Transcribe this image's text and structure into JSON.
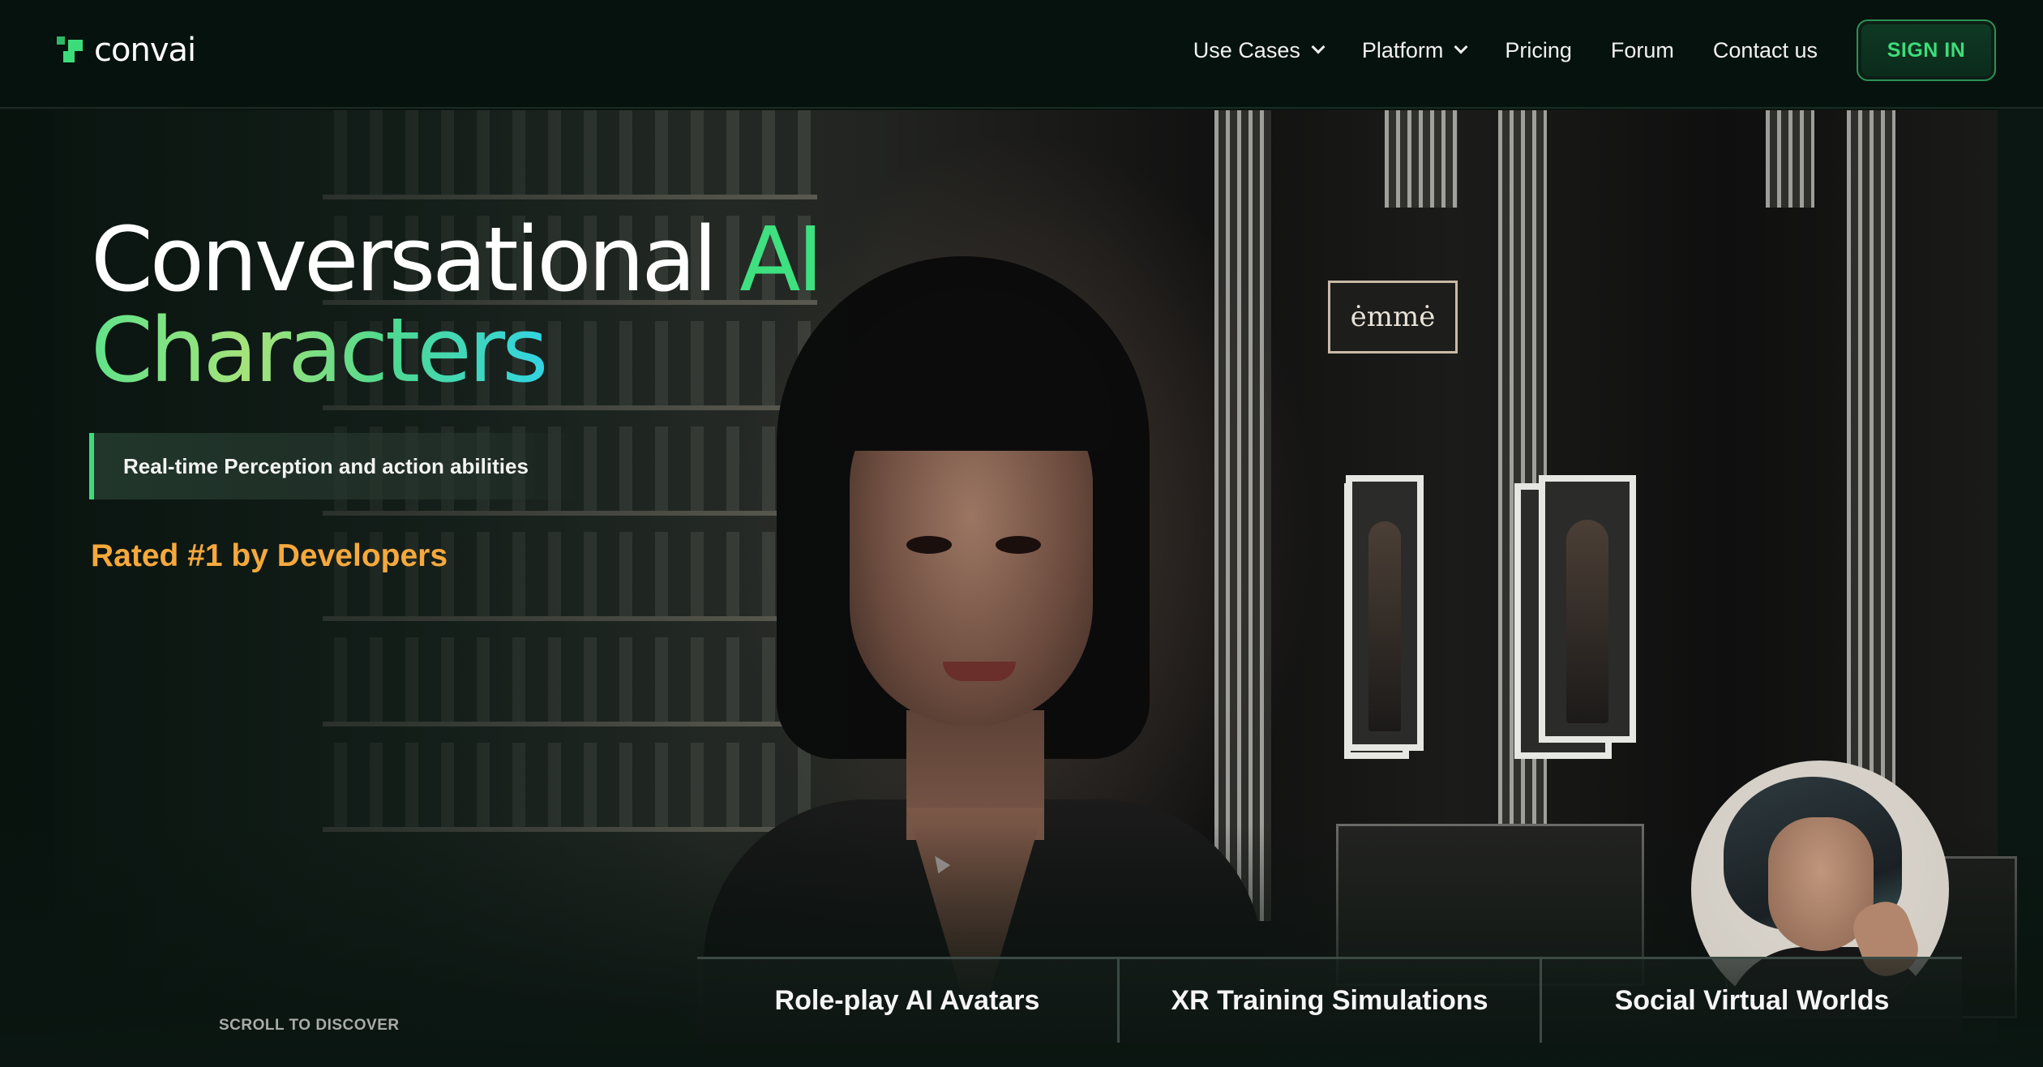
{
  "brand": {
    "name": "convai",
    "accent": "#3ddc7a"
  },
  "nav": {
    "items": [
      {
        "label": "Use Cases",
        "dropdown": true
      },
      {
        "label": "Platform",
        "dropdown": true
      },
      {
        "label": "Pricing",
        "dropdown": false
      },
      {
        "label": "Forum",
        "dropdown": false
      },
      {
        "label": "Contact us",
        "dropdown": false
      }
    ],
    "signin_label": "SIGN IN"
  },
  "hero": {
    "headline_part1": "Conversational ",
    "headline_accent": "AI",
    "headline_line2": "Characters",
    "badge_text": "Real-time Perception and action abilities",
    "rated_text": "Rated #1 by Developers",
    "scroll_text": "SCROLL TO DISCOVER",
    "store_sign": "ėmmė"
  },
  "tabs": [
    {
      "label": "Role-play AI Avatars"
    },
    {
      "label": "XR Training Simulations"
    },
    {
      "label": "Social Virtual Worlds"
    }
  ],
  "colors": {
    "rated": "#f5a93c",
    "signin_text": "#3ddc7a",
    "background": "#0b1712"
  }
}
